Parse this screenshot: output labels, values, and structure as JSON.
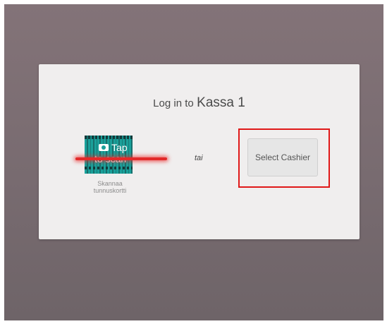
{
  "login": {
    "title_prefix": "Log in to",
    "register_name": "Kassa 1",
    "scan_button_label": "Tap to scan",
    "scan_caption": "Skannaa tunnuskortti",
    "or_text": "tai",
    "select_cashier_label": "Select Cashier"
  },
  "colors": {
    "scan_button": "#1aa09a",
    "laser": "#e22a2a",
    "highlight_border": "#e01818"
  },
  "icons": {
    "scan": "camera-icon"
  }
}
